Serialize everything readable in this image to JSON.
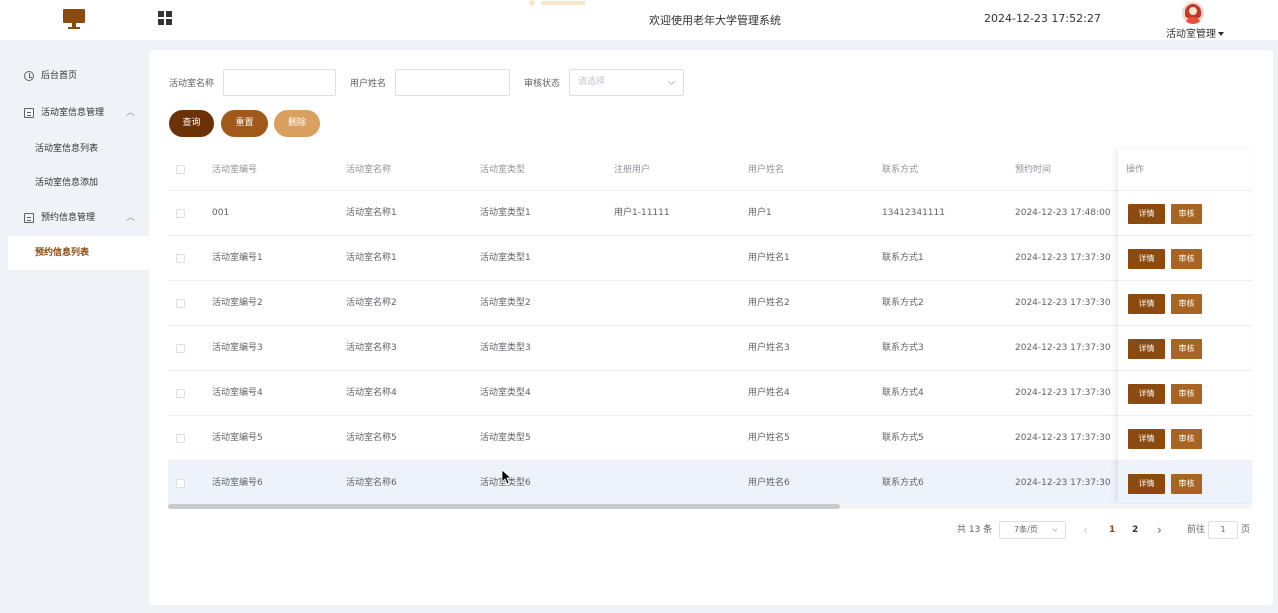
{
  "colors": {
    "brand": "#8b4a10",
    "query_btn": "#6b3208",
    "reset_btn": "#a0591b",
    "delete_btn": "#d9a060",
    "detail_btn": "#8b4a10",
    "audit_btn": "#a86422"
  },
  "header": {
    "welcome": "欢迎使用老年大学管理系统",
    "datetime": "2024-12-23 17:52:27",
    "user_menu": "活动室管理",
    "icons": [
      "monitor-logo-icon",
      "grid-icon",
      "avatar"
    ]
  },
  "sidebar": {
    "home": "后台首页",
    "group1": "活动室信息管理",
    "group1_items": [
      "活动室信息列表",
      "活动室信息添加"
    ],
    "group2": "预约信息管理",
    "group2_items": [
      "预约信息列表"
    ],
    "active": "预约信息列表"
  },
  "filters": {
    "room_name_label": "活动室名称",
    "room_name_value": "",
    "user_name_label": "用户姓名",
    "user_name_value": "",
    "status_label": "审核状态",
    "status_placeholder": "请选择"
  },
  "buttons": {
    "query": "查询",
    "reset": "重置",
    "delete": "删除"
  },
  "table": {
    "headers": [
      "活动室编号",
      "活动室名称",
      "活动室类型",
      "注册用户",
      "用户姓名",
      "联系方式",
      "预约时间",
      "操作"
    ],
    "rows": [
      [
        "001",
        "活动室名称1",
        "活动室类型1",
        "用户1-11111",
        "用户1",
        "13412341111",
        "2024-12-23 17:48:00"
      ],
      [
        "活动室编号1",
        "活动室名称1",
        "活动室类型1",
        "",
        "用户姓名1",
        "联系方式1",
        "2024-12-23 17:37:30"
      ],
      [
        "活动室编号2",
        "活动室名称2",
        "活动室类型2",
        "",
        "用户姓名2",
        "联系方式2",
        "2024-12-23 17:37:30"
      ],
      [
        "活动室编号3",
        "活动室名称3",
        "活动室类型3",
        "",
        "用户姓名3",
        "联系方式3",
        "2024-12-23 17:37:30"
      ],
      [
        "活动室编号4",
        "活动室名称4",
        "活动室类型4",
        "",
        "用户姓名4",
        "联系方式4",
        "2024-12-23 17:37:30"
      ],
      [
        "活动室编号5",
        "活动室名称5",
        "活动室类型5",
        "",
        "用户姓名5",
        "联系方式5",
        "2024-12-23 17:37:30"
      ],
      [
        "活动室编号6",
        "活动室名称6",
        "活动室类型6",
        "",
        "用户姓名6",
        "联系方式6",
        "2024-12-23 17:37:30"
      ]
    ],
    "hovered_row": 6,
    "detail_label": "详情",
    "audit_label": "审核"
  },
  "pagination": {
    "total": "共 13 条",
    "page_size": "7条/页",
    "pages": [
      "1",
      "2"
    ],
    "current": "1",
    "goto_prefix": "前往",
    "goto_value": "1",
    "goto_suffix": "页",
    "prev_icon": "‹",
    "next_icon": "›"
  }
}
